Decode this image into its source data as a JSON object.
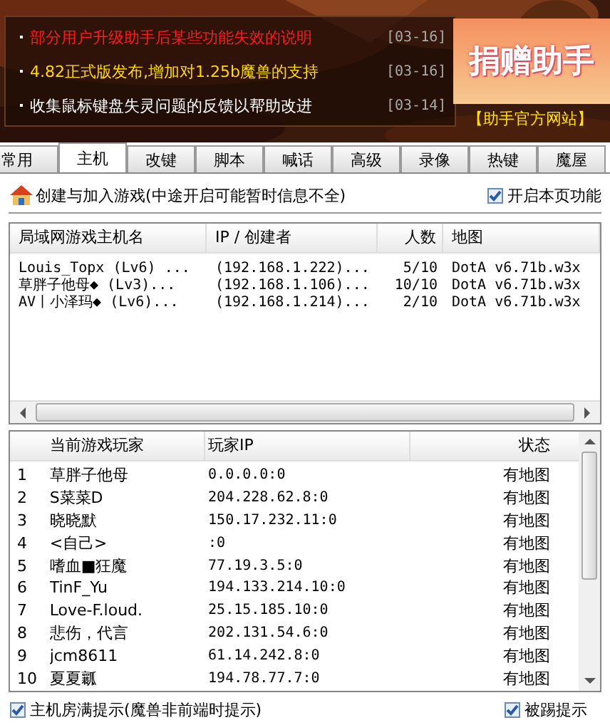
{
  "news": [
    {
      "text": "部分用户升级助手后某些功能失效的说明",
      "date": "[03-16]",
      "color": "#ff1a1a"
    },
    {
      "text": "4.82正式版发布,增加对1.25b魔兽的支持",
      "date": "[03-16]",
      "color": "#ffd800"
    },
    {
      "text": "收集鼠标键盘失灵问题的反馈以帮助改进",
      "date": "[03-14]",
      "color": "#ffffff"
    }
  ],
  "donate": {
    "label": "捐赠助手",
    "site_link": "【助手官方网站】"
  },
  "tabs": [
    {
      "label": "常用",
      "selected": false
    },
    {
      "label": "主机",
      "selected": true
    },
    {
      "label": "改键",
      "selected": false
    },
    {
      "label": "脚本",
      "selected": false
    },
    {
      "label": "喊话",
      "selected": false
    },
    {
      "label": "高级",
      "selected": false
    },
    {
      "label": "录像",
      "selected": false
    },
    {
      "label": "热键",
      "selected": false
    },
    {
      "label": "魔屋",
      "selected": false
    }
  ],
  "section": {
    "title": "创建与加入游戏(中途开启可能暂时信息不全)",
    "enable": {
      "label": "开启本页功能",
      "checked": true
    }
  },
  "hosts": {
    "columns": [
      "局域网游戏主机名",
      "IP / 创建者",
      "人数",
      "地图"
    ],
    "rows": [
      {
        "name": "Louis_Topx (Lv6) ...",
        "ip": "(192.168.1.222)...",
        "count": "5/10",
        "map": "DotA v6.71b.w3x"
      },
      {
        "name": "草胖子他母◆ (Lv3)...",
        "ip": "(192.168.1.106)...",
        "count": "10/10",
        "map": "DotA v6.71b.w3x"
      },
      {
        "name": "AV丨小泽玛◆ (Lv6)...",
        "ip": "(192.168.1.214)...",
        "count": "2/10",
        "map": "DotA v6.71b.w3x"
      }
    ]
  },
  "players": {
    "columns": [
      "当前游戏玩家",
      "玩家IP",
      "状态"
    ],
    "rows": [
      {
        "num": "1",
        "name": "草胖子他母",
        "ip": "0.0.0.0:0",
        "status": "有地图"
      },
      {
        "num": "2",
        "name": "S菜菜D",
        "ip": "204.228.62.8:0",
        "status": "有地图"
      },
      {
        "num": "3",
        "name": "晓晓默",
        "ip": "150.17.232.11:0",
        "status": "有地图"
      },
      {
        "num": "4",
        "name": "<自己>",
        "ip": ":0",
        "status": "有地图"
      },
      {
        "num": "5",
        "name": "嗜血■狂魔",
        "ip": "77.19.3.5:0",
        "status": "有地图"
      },
      {
        "num": "6",
        "name": "TinF_Yu",
        "ip": "194.133.214.10:0",
        "status": "有地图"
      },
      {
        "num": "7",
        "name": "Love-F.loud.",
        "ip": "25.15.185.10:0",
        "status": "有地图"
      },
      {
        "num": "8",
        "name": "悲伤，代言",
        "ip": "202.131.54.6:0",
        "status": "有地图"
      },
      {
        "num": "9",
        "name": "jcm8611",
        "ip": "61.14.242.8:0",
        "status": "有地图"
      },
      {
        "num": "10",
        "name": "夏夏瓤",
        "ip": "194.78.77.7:0",
        "status": "有地图"
      }
    ]
  },
  "options": [
    {
      "label": "主机房满提示(魔兽非前端时提示)",
      "checked": true
    },
    {
      "label": "被踢提示",
      "checked": true
    }
  ]
}
